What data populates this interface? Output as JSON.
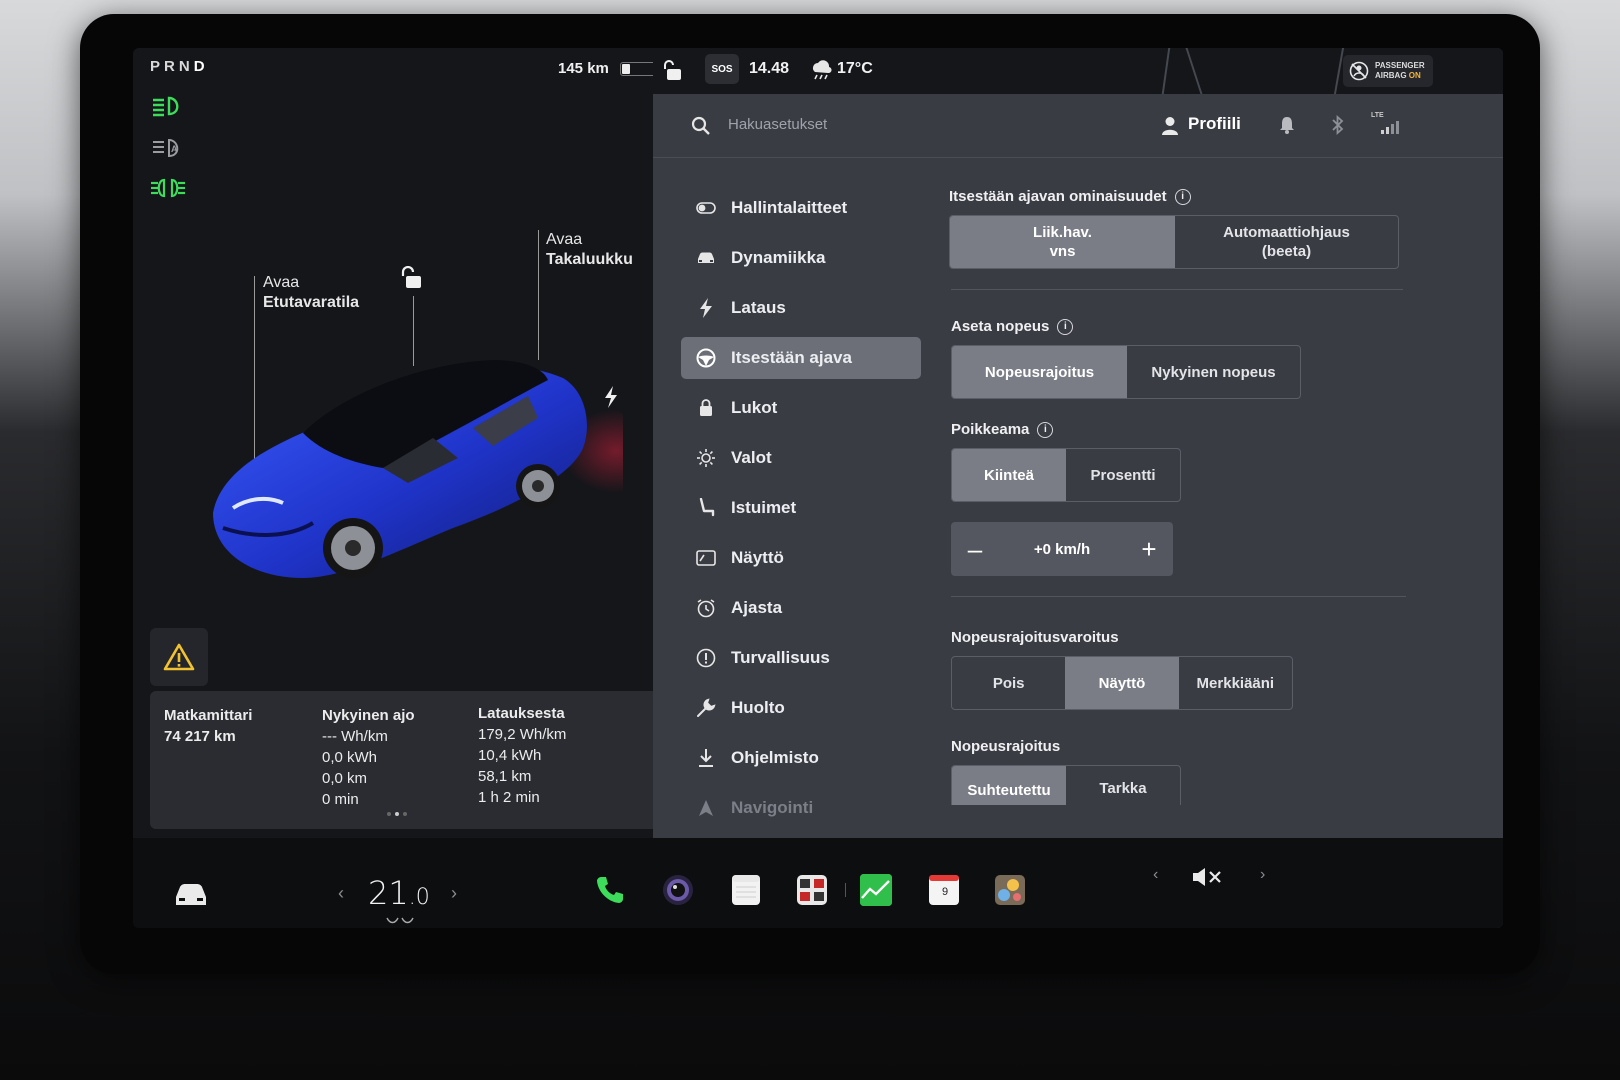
{
  "car_panel": {
    "gear": {
      "letters": [
        "P",
        "R",
        "N",
        "D"
      ]
    },
    "range": "145 km",
    "front_trunk": {
      "line1": "Avaa",
      "line2": "Etutavaratila"
    },
    "rear_trunk": {
      "line1": "Avaa",
      "line2": "Takaluukku"
    },
    "stats": {
      "odometer": {
        "title": "Matkamittari",
        "value": "74 217 km"
      },
      "current_trip": {
        "title": "Nykyinen ajo",
        "energy_rate": "--- Wh/km",
        "energy": "0,0 kWh",
        "distance": "0,0 km",
        "duration": "0 min"
      },
      "since_charge": {
        "title": "Latauksesta",
        "energy_rate": "179,2 Wh/km",
        "energy": "10,4 kWh",
        "distance": "58,1 km",
        "duration": "1 h 2 min"
      }
    }
  },
  "status_bar": {
    "sos": "SOS",
    "time": "14.48",
    "temperature": "17°C",
    "airbag_line1": "PASSENGER",
    "airbag_line2_prefix": "AIRBAG",
    "airbag_line2_state": "ON",
    "lte": "LTE"
  },
  "top_bar": {
    "search_placeholder": "Hakuasetukset",
    "profile_label": "Profiili"
  },
  "menu": [
    {
      "label": "Hallintalaitteet",
      "icon": "toggle-icon"
    },
    {
      "label": "Dynamiikka",
      "icon": "car-icon"
    },
    {
      "label": "Lataus",
      "icon": "bolt-icon"
    },
    {
      "label": "Itsestään ajava",
      "icon": "steering-wheel-icon",
      "active": true
    },
    {
      "label": "Lukot",
      "icon": "lock-icon"
    },
    {
      "label": "Valot",
      "icon": "sun-icon"
    },
    {
      "label": "Istuimet",
      "icon": "seat-icon"
    },
    {
      "label": "Näyttö",
      "icon": "display-icon"
    },
    {
      "label": "Ajasta",
      "icon": "clock-icon"
    },
    {
      "label": "Turvallisuus",
      "icon": "alert-circle-icon"
    },
    {
      "label": "Huolto",
      "icon": "wrench-icon"
    },
    {
      "label": "Ohjelmisto",
      "icon": "download-icon"
    },
    {
      "label": "Navigointi",
      "icon": "navigation-icon"
    }
  ],
  "settings": {
    "autopilot_features": {
      "title": "Itsestään ajavan ominaisuudet",
      "option1_line1": "Liik.hav.",
      "option1_line2": "vns",
      "option2_line1": "Automaattiohjaus",
      "option2_line2": "(beeta)",
      "selected": 0
    },
    "set_speed": {
      "title": "Aseta nopeus",
      "options": [
        "Nopeusrajoitus",
        "Nykyinen nopeus"
      ],
      "selected": 0
    },
    "offset": {
      "title": "Poikkeama",
      "options": [
        "Kiinteä",
        "Prosentti"
      ],
      "selected": 0,
      "value": "+0 km/h"
    },
    "speed_limit_warning": {
      "title": "Nopeusrajoitusvaroitus",
      "options": [
        "Pois",
        "Näyttö",
        "Merkkiääni"
      ],
      "selected": 1
    },
    "speed_limit": {
      "title": "Nopeusrajoitus",
      "options": [
        "Suhteutettu",
        "Tarkka"
      ],
      "selected": 0
    }
  },
  "dock": {
    "temperature_whole": "21",
    "temperature_decimal": ".0",
    "calendar_day": "9"
  },
  "colors": {
    "accent_green": "#3ddc5a",
    "selected_segment": "#7a7d86",
    "panel_bg": "#3a3c44"
  }
}
